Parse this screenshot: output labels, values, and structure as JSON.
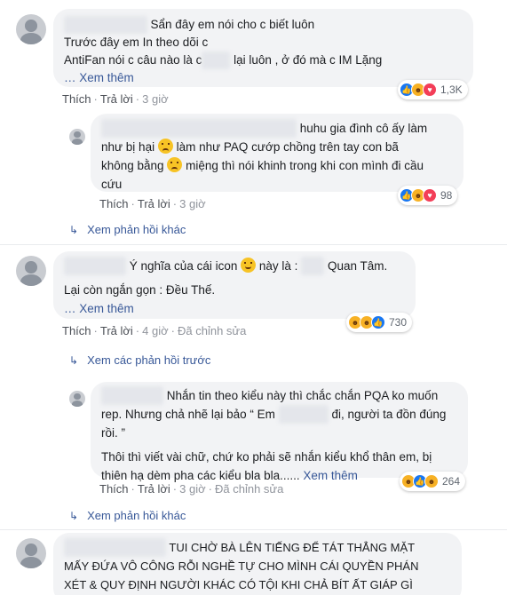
{
  "comment1": {
    "text_line1": "Sẩn đây em nói cho c biết luôn",
    "text_line2": "Trước đây em In theo dõi c",
    "text_line3a": "AntiFan nói c câu nào là c",
    "text_line3b": "lại luôn , ở đó mà c IM Lặng",
    "see_more": "… Xem thêm",
    "reaction_count": "1,3K",
    "like": "Thích",
    "reply": "Trả lời",
    "time": "3 giờ"
  },
  "reply1": {
    "text_line1": "huhu gia đình cô ấy làm",
    "text_line2a": "như bị hại",
    "text_line2b": "làm như PAQ cướp chồng trên tay con bã",
    "text_line3a": "không bằng",
    "text_line3b": "miệng thì nói khinh trong khi con mình đi cầu",
    "text_line4": "cứu",
    "reaction_count": "98",
    "like": "Thích",
    "reply": "Trả lời",
    "time": "3 giờ"
  },
  "more_replies1": "Xem phản hồi khác",
  "comment2": {
    "text_line1a": "Ý nghĩa của cái icon",
    "text_line1b": "này là :",
    "text_line1c": "Quan Tâm.",
    "text_line2": "Lại còn ngắn gọn : Đều Thế.",
    "see_more": "… Xem thêm",
    "reaction_count": "730",
    "like": "Thích",
    "reply": "Trả lời",
    "time": "4 giờ",
    "edited": "Đã chỉnh sửa"
  },
  "previous_replies": "Xem các phản hồi trước",
  "reply2": {
    "text_line1": "Nhắn tin theo kiểu này thì chắc chắn PQA ko muốn",
    "text_line2a": "rep. Nhưng chả nhẽ lại bảo “ Em",
    "text_line2b": "đi, người ta đồn đúng",
    "text_line3": "rồi. ”",
    "text_line4": "Thôi thì viết vài chữ, chứ ko phải sẽ nhắn kiểu khổ thân em, bị",
    "text_line5": "thiên hạ dèm pha các kiểu bla bla......",
    "see_more": "Xem thêm",
    "reaction_count": "264",
    "like": "Thích",
    "reply": "Trả lời",
    "time": "3 giờ",
    "edited": "Đã chỉnh sửa"
  },
  "more_replies2": "Xem phản hồi khác",
  "comment3": {
    "text_line1": "TUI CHỜ BÀ LÊN TIẾNG ĐỂ TÁT THẲNG MẶT",
    "text_line2": "MẤY ĐỨA VÔ CÔNG RỖI NGHỀ TỰ CHO MÌNH CÁI QUYỀN PHÁN",
    "text_line3": "XÉT & QUY ĐỊNH NGƯỜI KHÁC CÓ TỘI KHI CHẢ BÍT ẤT GIÁP GÌ"
  },
  "colors": {
    "link": "#385898",
    "bubble": "#f2f3f5",
    "like": "#1877f2",
    "love": "#f33e58",
    "haha": "#f7b125"
  }
}
